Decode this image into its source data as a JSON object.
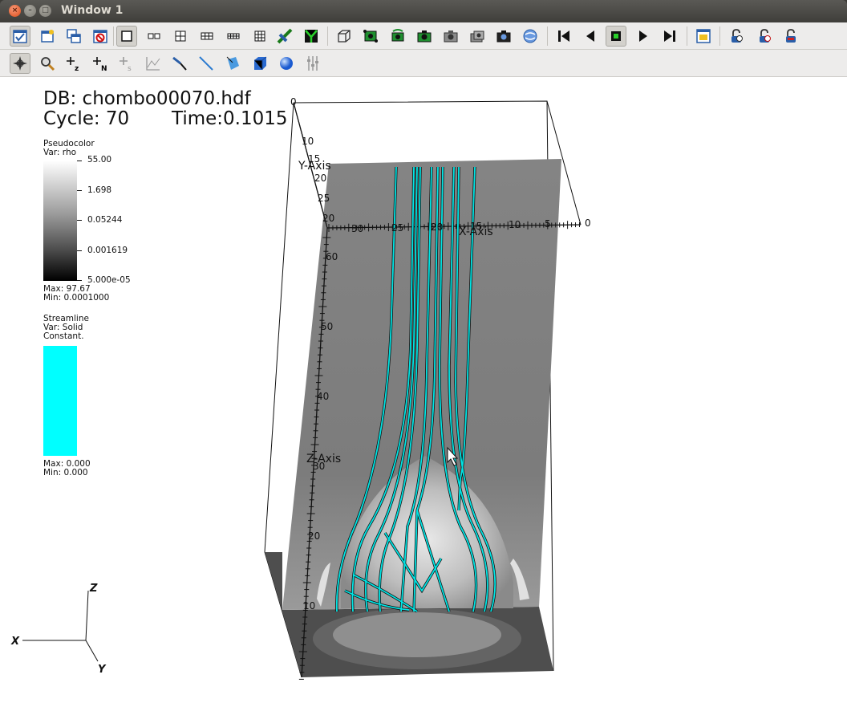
{
  "window": {
    "title": "Window 1"
  },
  "toolbar_top": {
    "icons": [
      "active-window-icon",
      "new-window-icon",
      "clone-window-icon",
      "delete-window-icon",
      "layout-1x1-icon",
      "layout-1x2-icon",
      "layout-2x2-icon",
      "layout-2x3-icon",
      "layout-2x4-icon",
      "layout-3x3-icon",
      "lock-view-icon",
      "lock-time-icon",
      "reset-view-icon",
      "recenter-view-icon",
      "undo-view-icon",
      "save-image-icon",
      "copy-view-icon",
      "paste-view-icon",
      "print-icon",
      "spin-icon",
      "rewind-icon",
      "reverse-play-icon",
      "stop-icon",
      "play-icon",
      "step-forward-icon",
      "open-file-icon",
      "lock-icon-1",
      "lock-icon-2",
      "lock-icon-3"
    ]
  },
  "toolbar_bottom": {
    "icons": [
      "navigate-mode-icon",
      "zoom-mode-icon",
      "zone-pick-icon",
      "node-pick-icon",
      "spreadsheet-pick-icon",
      "lineout-icon",
      "point-tool-icon",
      "line-tool-icon",
      "plane-tool-icon",
      "box-tool-icon",
      "sphere-tool-icon",
      "axis-tool-icon"
    ]
  },
  "annotation": {
    "db": "DB: chombo00070.hdf",
    "cycle": "Cycle: 70",
    "time": "Time:0.1015"
  },
  "legend_pseudocolor": {
    "plot_type": "Pseudocolor",
    "var": "Var: rho",
    "ticks": [
      "55.00",
      "1.698",
      "0.05244",
      "0.001619",
      "5.000e-05"
    ],
    "max": "Max: 97.67",
    "min": "Min: 0.0001000"
  },
  "legend_streamline": {
    "plot_type": "Streamline",
    "var": "Var: Solid",
    "mode": "Constant.",
    "max": "Max: 0.000",
    "min": "Min: 0.000",
    "color": "#00ffff"
  },
  "axes3d": {
    "y_title": "Y-Axis",
    "x_title": "X-Axis",
    "z_title": "Z-Axis",
    "y_ticks": [
      "0",
      "10",
      "15",
      "20",
      "25",
      "20"
    ],
    "x_ticks": [
      "30",
      "25",
      "20",
      "15",
      "10",
      "5",
      "0"
    ],
    "z_ticks": [
      "60",
      "50",
      "40",
      "30",
      "20",
      "10"
    ]
  },
  "triad": {
    "x": "X",
    "y": "Y",
    "z": "Z"
  }
}
